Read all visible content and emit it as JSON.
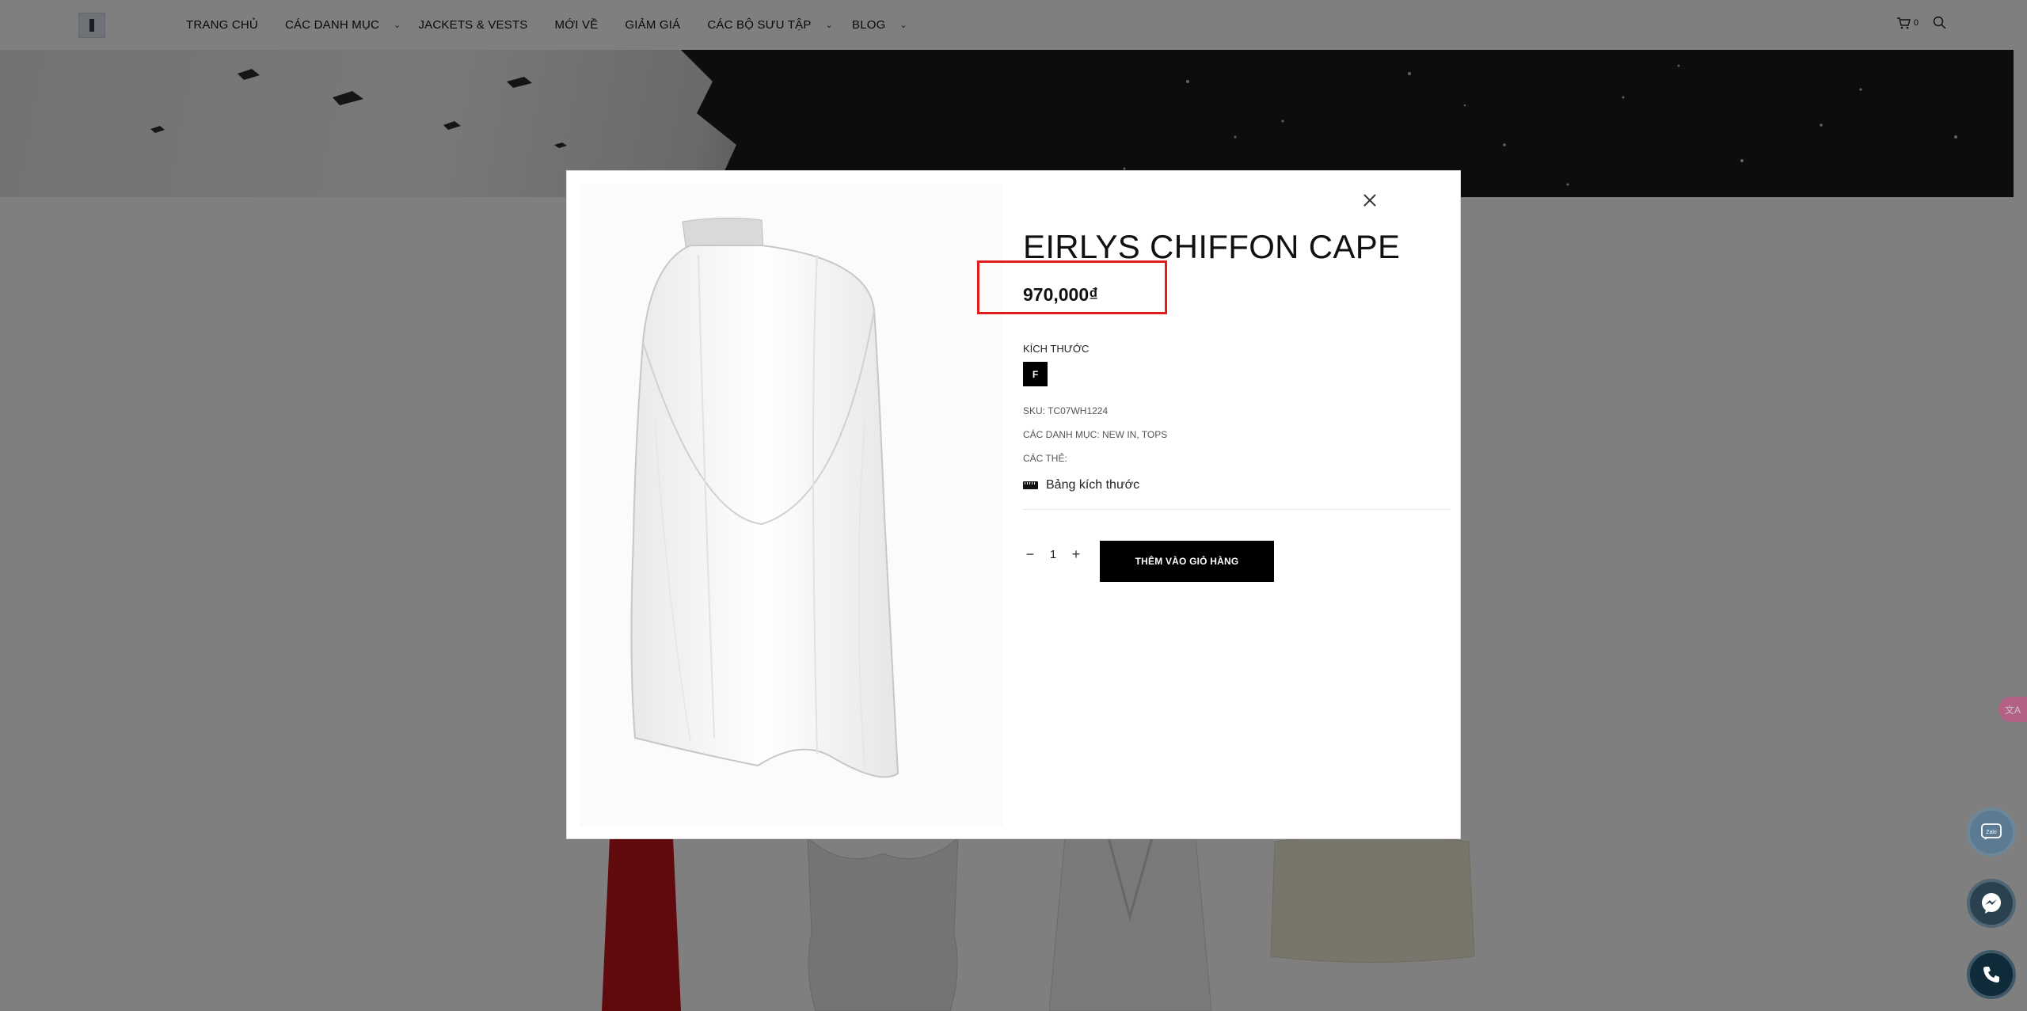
{
  "header": {
    "nav": [
      {
        "label": "TRANG CHỦ"
      },
      {
        "label": "CÁC DANH MỤC"
      },
      {
        "label": "JACKETS & VESTS"
      },
      {
        "label": "MỚI VỀ"
      },
      {
        "label": "GIẢM GIÁ"
      },
      {
        "label": "CÁC BỘ SƯU TẬP"
      },
      {
        "label": "BLOG"
      }
    ],
    "cart_count": "0"
  },
  "modal": {
    "title": "EIRLYS CHIFFON CAPE",
    "price": "970,000₫",
    "size_label": "KÍCH THƯỚC",
    "size_option": "F",
    "sku": "SKU: TC07WH1224",
    "categories": "CÁC DANH MỤC: NEW IN, TOPS",
    "tags": "CÁC THẺ:",
    "size_guide": "Bảng kích thước",
    "quantity": "1",
    "add_to_cart": "THÊM VÀO GIỎ HÀNG",
    "highlight_color": "#e21b1b"
  },
  "floating": {
    "translate": "文A",
    "zalo": "Zalo"
  },
  "icons": [
    "logo",
    "chevron-down-icon",
    "cart-icon",
    "search-icon",
    "close-icon",
    "ruler-icon",
    "minus-icon",
    "plus-icon",
    "translate-icon",
    "zalo-icon",
    "messenger-icon",
    "phone-icon"
  ]
}
